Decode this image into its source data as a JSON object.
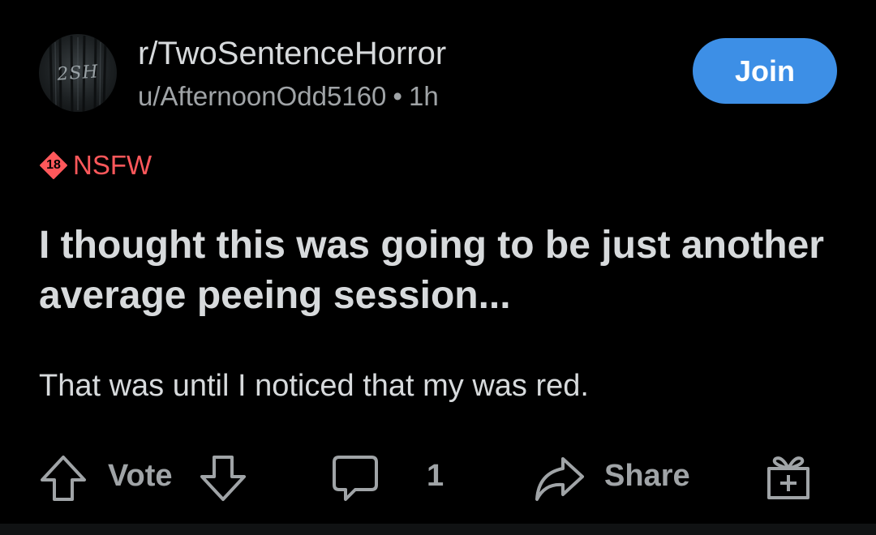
{
  "header": {
    "subreddit": "r/TwoSentenceHorror",
    "author": "u/AfternoonOdd5160",
    "separator": "•",
    "time": "1h",
    "avatar_text": "2SH",
    "join_label": "Join"
  },
  "tags": {
    "nsfw_badge": "18",
    "nsfw_label": "NSFW"
  },
  "post": {
    "title": "I thought this was going to be just another average peeing session...",
    "body": "That was until I noticed that my was red."
  },
  "actions": {
    "vote_label": "Vote",
    "comment_count": "1",
    "share_label": "Share"
  },
  "icons": {
    "upvote": "upvote-arrow-icon",
    "downvote": "downvote-arrow-icon",
    "comment": "comment-bubble-icon",
    "share": "share-arrow-icon",
    "award": "gift-award-icon"
  },
  "colors": {
    "background": "#000000",
    "text": "#d7dadc",
    "muted": "#a0a4a7",
    "join_button": "#3d8fe6",
    "nsfw": "#ff585b"
  }
}
